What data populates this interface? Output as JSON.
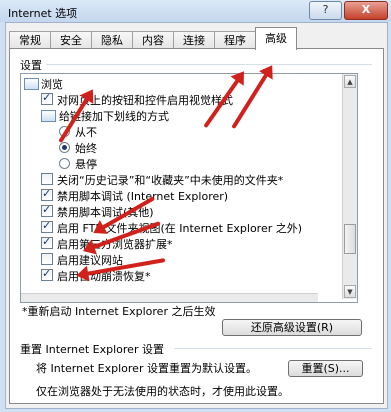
{
  "window": {
    "title": "Internet 选项",
    "help_label": "?",
    "close_label": "X"
  },
  "tabs": [
    "常规",
    "安全",
    "隐私",
    "内容",
    "连接",
    "程序",
    "高级"
  ],
  "active_tab": "高级",
  "settings_group_label": "设置",
  "list_items": [
    {
      "type": "folder",
      "label": "浏览"
    },
    {
      "type": "checkbox",
      "checked": true,
      "label": "对网页上的按钮和控件启用视觉样式"
    },
    {
      "type": "folder",
      "label": "给链接加下划线的方式"
    },
    {
      "type": "radio",
      "checked": false,
      "label": "从不"
    },
    {
      "type": "radio",
      "checked": true,
      "label": "始终"
    },
    {
      "type": "radio",
      "checked": false,
      "label": "悬停"
    },
    {
      "type": "checkbox",
      "checked": false,
      "label": "关闭“历史记录”和“收藏夹”中未使用的文件夹*"
    },
    {
      "type": "checkbox",
      "checked": true,
      "label": "禁用脚本调试 (Internet Explorer)"
    },
    {
      "type": "checkbox",
      "checked": true,
      "label": "禁用脚本调试(其他)"
    },
    {
      "type": "checkbox",
      "checked": true,
      "label": "启用 FTP 文件夹视图(在 Internet Explorer 之外)"
    },
    {
      "type": "checkbox",
      "checked": true,
      "label": "启用第三方浏览器扩展*"
    },
    {
      "type": "checkbox",
      "checked": false,
      "label": "启用建议网站"
    },
    {
      "type": "checkbox",
      "checked": true,
      "label": "启用自动崩溃恢复*"
    }
  ],
  "restart_note": "*重新启动 Internet Explorer 之后生效",
  "restore_advanced_button": "还原高级设置(R)",
  "reset_group_label": "重置 Internet Explorer 设置",
  "reset_description": "将 Internet Explorer 设置重置为默认设置。",
  "reset_button": "重置(S)...",
  "reset_note": "仅在浏览器处于无法使用的状态时，才使用此设置。",
  "colors": {
    "annotation_arrow": "#d0221b"
  }
}
